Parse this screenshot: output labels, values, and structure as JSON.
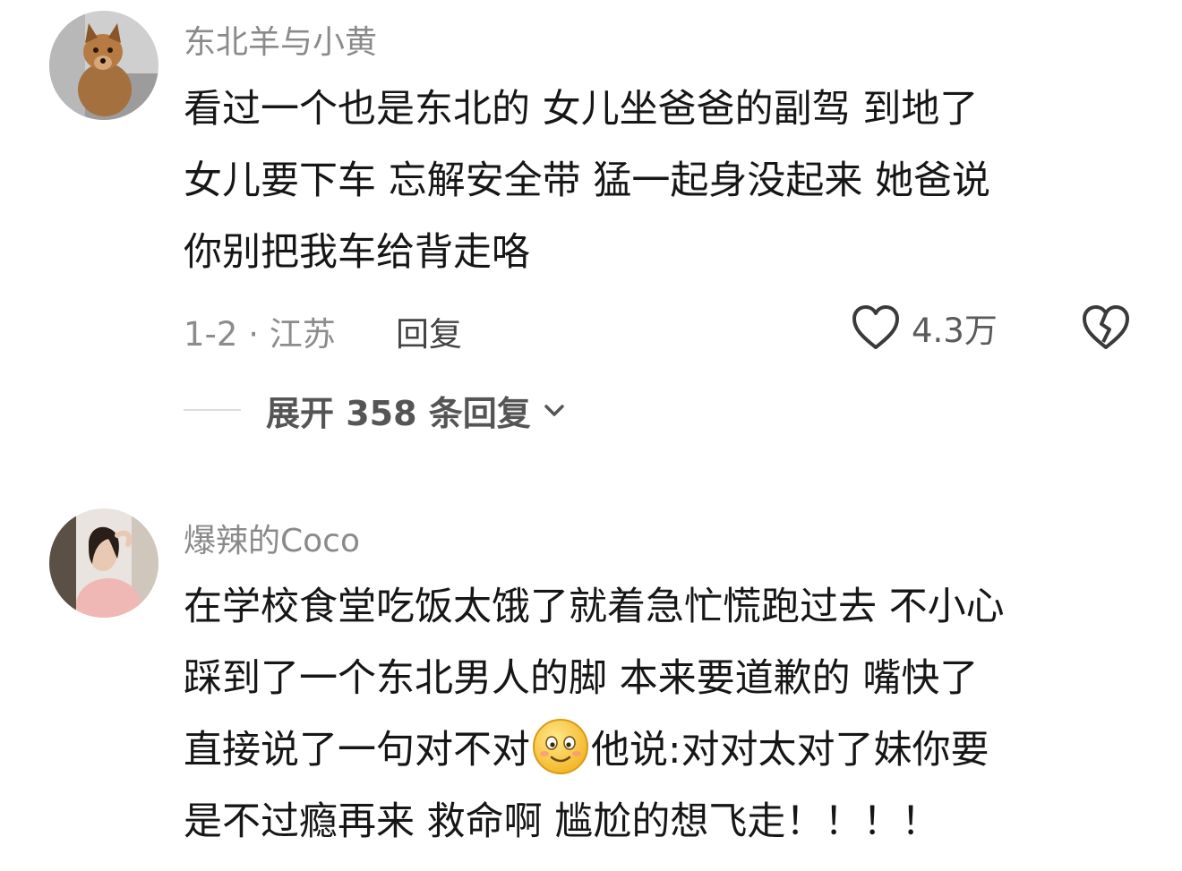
{
  "comments": [
    {
      "username": "东北羊与小黄",
      "avatar_icon": "dog-avatar",
      "lines": [
        "看过一个也是东北的 女儿坐爸爸的副驾 到地了",
        "女儿要下车 忘解安全带 猛一起身没起来 她爸说",
        "你别把我车给背走咯"
      ],
      "meta": "1-2 · 江苏",
      "reply_label": "回复",
      "like_count": "4.3万",
      "expand_label": "展开 358 条回复"
    },
    {
      "username": "爆辣的Coco",
      "avatar_icon": "woman-photo-avatar",
      "lines": [
        "在学校食堂吃饭太饿了就着急忙慌跑过去 不小心",
        "踩到了一个东北男人的脚 本来要道歉的 嘴快了",
        "直接说了一句对不对",
        "他说:对对太对了妹你要",
        "是不过瘾再来 救命啊 尴尬的想飞走！！！！"
      ],
      "emoji": "smile-emoji"
    }
  ],
  "icons": {
    "like": "heart-outline-icon",
    "dislike": "broken-heart-icon",
    "expand": "chevron-down-icon"
  }
}
